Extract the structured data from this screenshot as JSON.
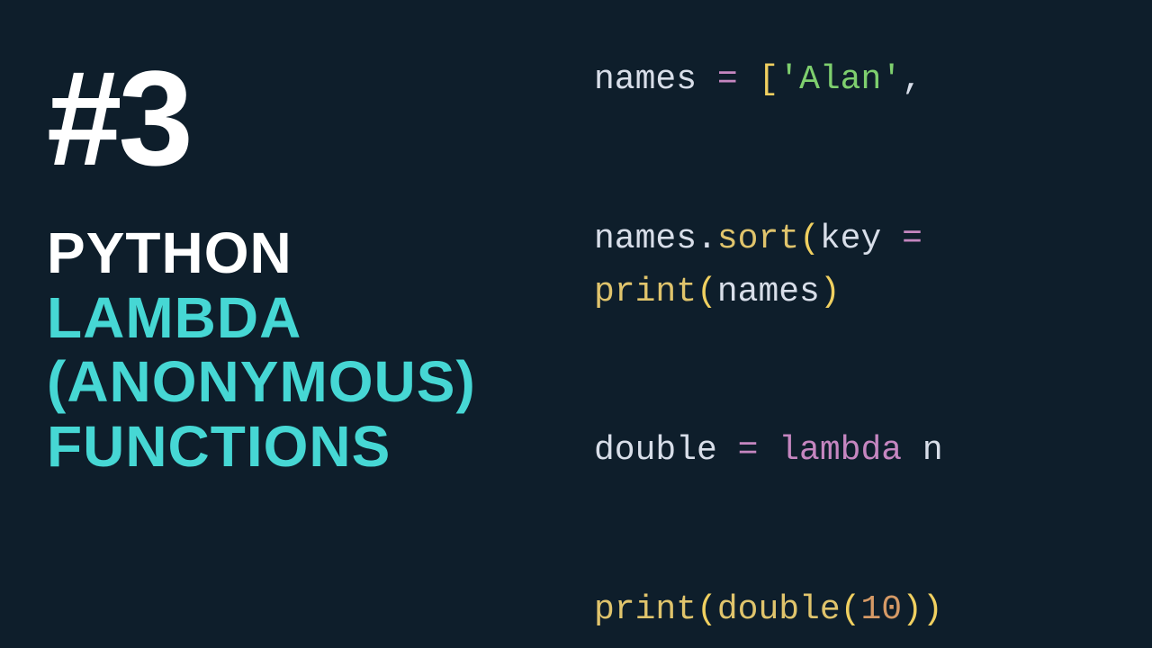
{
  "heading": {
    "episode": "#3",
    "line1": "PYTHON",
    "line2": "LAMBDA",
    "line3": "(ANONYMOUS)",
    "line4": "FUNCTIONS"
  },
  "code": {
    "l1": {
      "names": "names",
      "eq": " = ",
      "lb": "[",
      "str": "'Alan'",
      "comma": ","
    },
    "l3": {
      "names": "names",
      "dot": ".",
      "sort": "sort",
      "lp": "(",
      "key": "key",
      "eq": " = "
    },
    "l4": {
      "print": "print",
      "lp": "(",
      "names": "names",
      "rp": ")"
    },
    "l6": {
      "double": "double",
      "eq": " = ",
      "lambda": "lambda",
      "n": " n"
    },
    "l8": {
      "print": "print",
      "lp1": "(",
      "double": "double",
      "lp2": "(",
      "num": "10",
      "rp2": ")",
      "rp1": ")"
    }
  }
}
